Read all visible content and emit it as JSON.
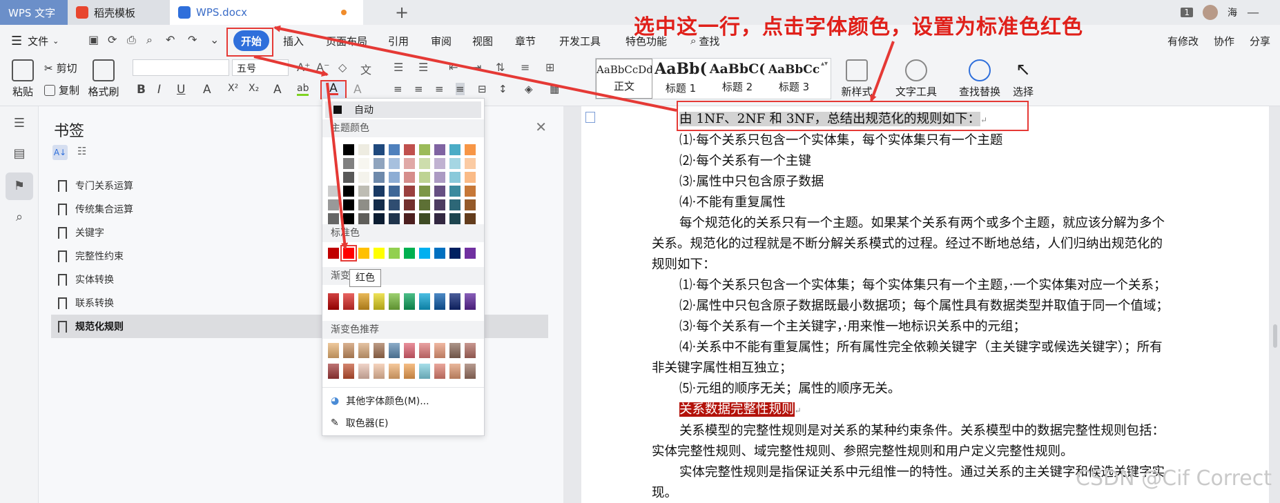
{
  "titlebar": {
    "tabs": [
      {
        "label": "WPS 文字"
      },
      {
        "label": "稻壳模板"
      },
      {
        "label": "WPS.docx"
      }
    ],
    "add_tab": "+",
    "badge": "1",
    "user": "海"
  },
  "menubar": {
    "file": "文件",
    "items": [
      "开始",
      "插入",
      "页面布局",
      "引用",
      "审阅",
      "视图",
      "章节",
      "开发工具",
      "特色功能",
      "查找"
    ],
    "right": [
      "有修改",
      "协作",
      "分享"
    ]
  },
  "ribbon": {
    "paste": "粘贴",
    "cut": "剪切",
    "copy": "复制",
    "format_painter": "格式刷",
    "font_size": "五号",
    "styles": [
      {
        "sample": "AaBbCcDd",
        "name": "正文"
      },
      {
        "sample": "AaBb(",
        "name": "标题 1"
      },
      {
        "sample": "AaBbC(",
        "name": "标题 2"
      },
      {
        "sample": "AaBbCc",
        "name": "标题 3"
      }
    ],
    "new_style": "新样式",
    "text_tools": "文字工具",
    "find_replace": "查找替换",
    "select": "选择"
  },
  "bookmarks": {
    "title": "书签",
    "items": [
      "专门关系运算",
      "传统集合运算",
      "关键字",
      "完整性约束",
      "实体转换",
      "联系转换",
      "规范化规则"
    ],
    "selected_index": 6
  },
  "color_menu": {
    "auto": "自动",
    "theme_colors": "主题颜色",
    "standard_colors": "标准色",
    "gradient": "渐变",
    "gradient_recommend": "渐变色推荐",
    "more_colors": "其他字体颜色(M)...",
    "eyedropper": "取色器(E)",
    "tooltip": "红色",
    "theme_row": [
      "#ffffff",
      "#000000",
      "#eeece1",
      "#1f497d",
      "#4f81bd",
      "#c0504d",
      "#9bbb59",
      "#8064a2",
      "#4bacc6",
      "#f79646"
    ],
    "standard_row": [
      "#c00000",
      "#ff0000",
      "#ffc000",
      "#ffff00",
      "#92d050",
      "#00b050",
      "#00b0f0",
      "#0070c0",
      "#002060",
      "#7030a0"
    ],
    "gradient_row": [
      "#c00000",
      "#e0302c",
      "#e0a020",
      "#e8d820",
      "#7cc040",
      "#10a860",
      "#10a8d8",
      "#1060b0",
      "#102878",
      "#6028a0"
    ]
  },
  "annotation": {
    "title": "选中这一行，点击字体颜色，设置为标准色红色"
  },
  "document": {
    "selected_line": "由 1NF、2NF 和 3NF，总结出规范化的规则如下：",
    "lines": [
      "⑴·每个关系只包含一个实体集，每个实体集只有一个主题",
      "⑵·每个关系有一个主键",
      "⑶·属性中只包含原子数据",
      "⑷·不能有重复属性"
    ],
    "para1_a": "每个规范化的关系只有一个主题。如果某个关系有两个或多个主题，就应该分解为多个",
    "para1_b": "关系。规范化的过程就是不断分解关系模式的过程。经过不断地总结，人们归纳出规范化的",
    "para1_c": "规则如下：",
    "rules": [
      "⑴·每个关系只包含一个实体集；每个实体集只有一个主题，·一个实体集对应一个关系；",
      "⑵·属性中只包含原子数据既最小数据项；每个属性具有数据类型并取值于同一个值域；",
      "⑶·每个关系有一个主关键字，·用来惟一地标识关系中的元组；",
      "⑷·关系中不能有重复属性；所有属性完全依赖关键字（主关键字或候选关键字）；所有"
    ],
    "rule4_cont": "非关键字属性相互独立；",
    "rule5": "⑸·元组的顺序无关；属性的顺序无关。",
    "heading_red": "关系数据完整性规则",
    "para2_a": "关系模型的完整性规则是对关系的某种约束条件。关系模型中的数据完整性规则包括：",
    "para2_b": "实体完整性规则、域完整性规则、参照完整性规则和用户定义完整性规则。",
    "para3_a": "实体完整性规则是指保证关系中元组惟一的特性。通过关系的主关键字和候选关键字实",
    "para3_b": "现。",
    "watermark": "CSDN @Cif Correct"
  }
}
